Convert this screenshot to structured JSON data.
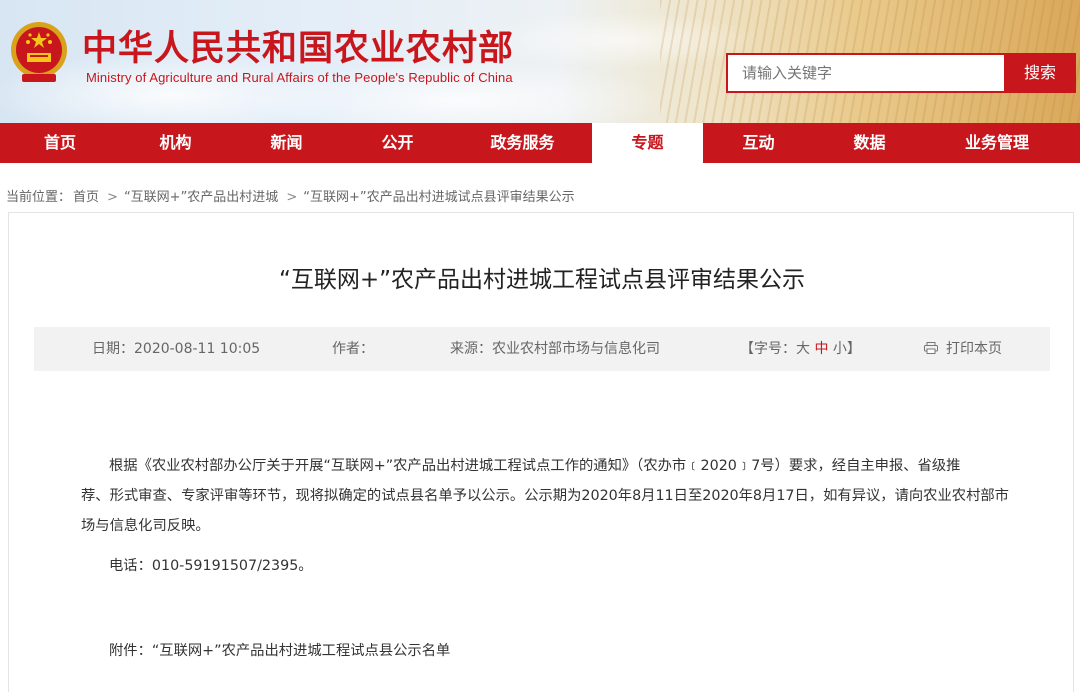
{
  "header": {
    "title": "中华人民共和国农业农村部",
    "subtitle": "Ministry of Agriculture and Rural Affairs of the People's Republic of China",
    "search_placeholder": "请输入关键字",
    "search_button": "搜索",
    "brand_color": "#c8161d"
  },
  "nav": {
    "items": [
      {
        "label": "首页"
      },
      {
        "label": "机构"
      },
      {
        "label": "新闻"
      },
      {
        "label": "公开"
      },
      {
        "label": "政务服务"
      },
      {
        "label": "专题"
      },
      {
        "label": "互动"
      },
      {
        "label": "数据"
      },
      {
        "label": "业务管理"
      }
    ],
    "active_index": 5
  },
  "breadcrumb": {
    "prefix": "当前位置：",
    "items": [
      "首页",
      "“互联网+”农产品出村进城",
      "“互联网+”农产品出村进城试点县评审结果公示"
    ],
    "separator": ">"
  },
  "article": {
    "title": "“互联网+”农产品出村进城工程试点县评审结果公示",
    "meta": {
      "date": "日期：2020-08-11 10:05",
      "author": "作者：",
      "source": "来源：农业农村部市场与信息化司",
      "font_size_prefix": "【字号：",
      "font_large": "大",
      "font_medium": "中",
      "font_small": "小",
      "font_size_suffix": "】",
      "print": "打印本页"
    },
    "paragraph1_line1": "根据《农业农村部办公厅关于开展“互联网+”农产品出村进城工程试点工作的通知》（农办市﹝2020﹞7号）要求，经自主申报、省级推",
    "paragraph1_line2": "荐、形式审查、专家评审等环节，现将拟确定的试点县名单予以公示。公示期为2020年8月11日至2020年8月17日，如有异议，请向农业农村部市",
    "paragraph1_line3": "场与信息化司反映。",
    "phone": "电话：010-59191507/2395。",
    "attachment": "附件：“互联网+”农产品出村进城工程试点县公示名单"
  }
}
